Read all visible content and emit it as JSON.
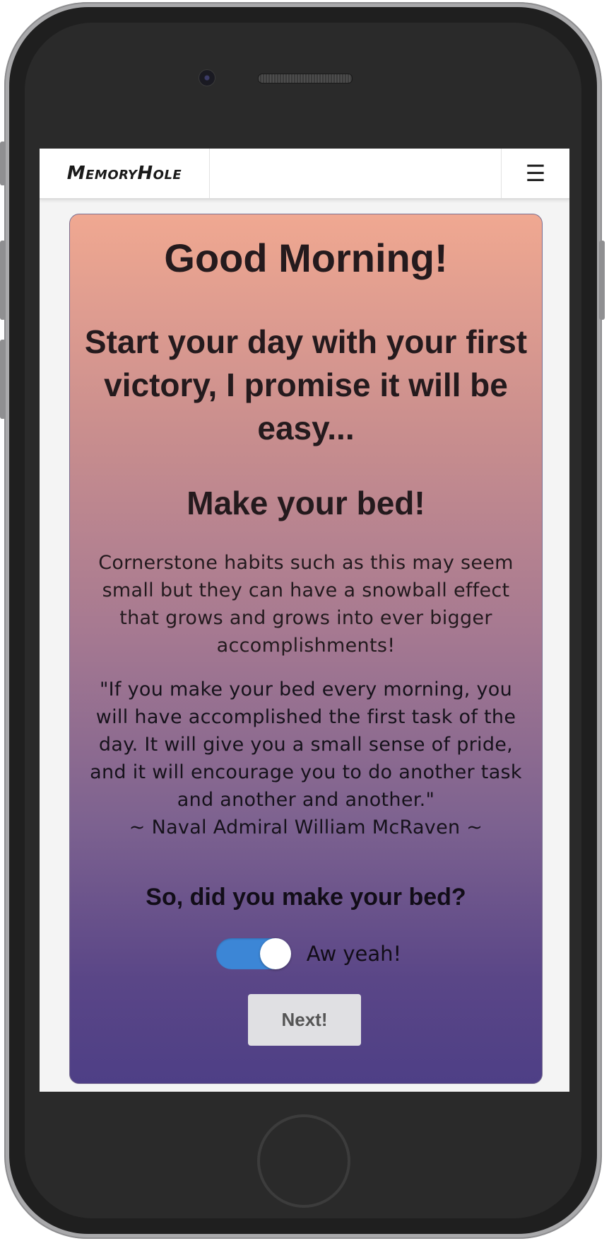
{
  "app": {
    "brand": "MemoryHole",
    "menu_icon": "hamburger-menu-icon"
  },
  "card": {
    "greeting": "Good Morning!",
    "subtitle": "Start your day with your first victory, I promise it will be easy...",
    "task": "Make your bed!",
    "description": "Cornerstone habits such as this may seem small but they can have a snowball effect that grows and grows into ever bigger accomplishments!",
    "quote": "\"If you make your bed every morning, you will have accomplished the first task of the day. It will give you a small sense of pride, and it will encourage you to do another task and another and another.\"",
    "quote_author": "~ Naval Admiral William McRaven ~",
    "question": "So, did you make your bed?",
    "toggle": {
      "checked": true,
      "label": "Aw yeah!",
      "color": "#3c86d6"
    },
    "next_button": "Next!"
  },
  "colors": {
    "gradient_top": "#f0a891",
    "gradient_bottom": "#4e3f86"
  }
}
